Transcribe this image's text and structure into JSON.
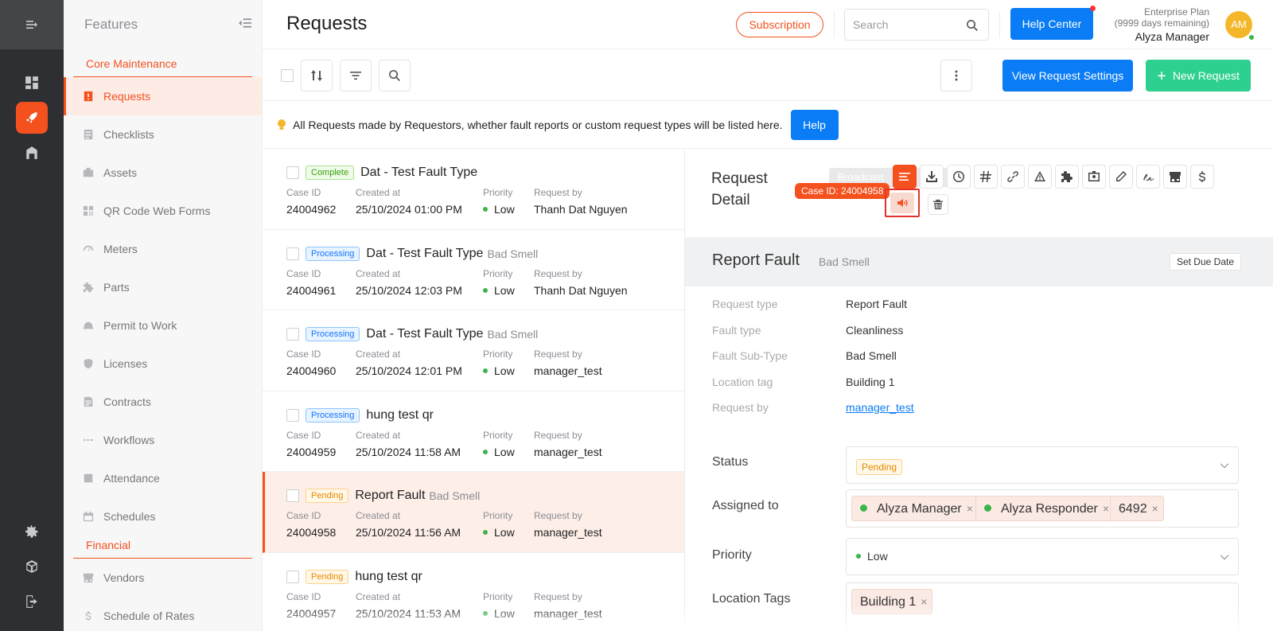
{
  "header": {
    "page_title": "Requests",
    "subscription_label": "Subscription",
    "search_placeholder": "Search",
    "help_center_label": "Help Center",
    "plan_name": "Enterprise Plan",
    "plan_days": "(9999 days remaining)",
    "user_name": "Alyza Manager",
    "avatar_initials": "AM"
  },
  "sidebar": {
    "title": "Features",
    "section_core": "Core Maintenance",
    "section_financial": "Financial",
    "items": [
      {
        "label": "Requests",
        "icon": "request-icon"
      },
      {
        "label": "Checklists",
        "icon": "checklist-icon"
      },
      {
        "label": "Assets",
        "icon": "asset-icon"
      },
      {
        "label": "QR Code Web Forms",
        "icon": "qr-code-icon"
      },
      {
        "label": "Meters",
        "icon": "meter-icon"
      },
      {
        "label": "Parts",
        "icon": "puzzle-icon"
      },
      {
        "label": "Permit to Work",
        "icon": "hard-hat-icon"
      },
      {
        "label": "Licenses",
        "icon": "shield-icon"
      },
      {
        "label": "Contracts",
        "icon": "contract-icon"
      },
      {
        "label": "Workflows",
        "icon": "workflow-icon"
      },
      {
        "label": "Attendance",
        "icon": "attendance-icon"
      },
      {
        "label": "Schedules",
        "icon": "calendar-icon"
      }
    ],
    "financial_items": [
      {
        "label": "Vendors",
        "icon": "store-icon"
      },
      {
        "label": "Schedule of Rates",
        "icon": "dollar-icon"
      }
    ]
  },
  "toolbar": {
    "view_settings_label": "View Request Settings",
    "new_request_label": "New Request"
  },
  "info": {
    "text": "All Requests made by Requestors, whether fault reports or custom request types will be listed here.",
    "help_label": "Help"
  },
  "list_headers": {
    "case_id": "Case ID",
    "created_at": "Created at",
    "priority": "Priority",
    "request_by": "Request by"
  },
  "requests": [
    {
      "status": "Complete",
      "title": "Dat - Test Fault Type",
      "subtitle": "",
      "case_id": "24004962",
      "created_at": "25/10/2024 01:00 PM",
      "priority": "Low",
      "request_by": "Thanh Dat Nguyen"
    },
    {
      "status": "Processing",
      "title": "Dat - Test Fault Type",
      "subtitle": "Bad Smell",
      "case_id": "24004961",
      "created_at": "25/10/2024 12:03 PM",
      "priority": "Low",
      "request_by": "Thanh Dat Nguyen"
    },
    {
      "status": "Processing",
      "title": "Dat - Test Fault Type",
      "subtitle": "Bad Smell",
      "case_id": "24004960",
      "created_at": "25/10/2024 12:01 PM",
      "priority": "Low",
      "request_by": "manager_test"
    },
    {
      "status": "Processing",
      "title": "hung test qr",
      "subtitle": "",
      "case_id": "24004959",
      "created_at": "25/10/2024 11:58 AM",
      "priority": "Low",
      "request_by": "manager_test"
    },
    {
      "status": "Pending",
      "title": "Report Fault",
      "subtitle": "Bad Smell",
      "case_id": "24004958",
      "created_at": "25/10/2024 11:56 AM",
      "priority": "Low",
      "request_by": "manager_test"
    },
    {
      "status": "Pending",
      "title": "hung test qr",
      "subtitle": "",
      "case_id": "24004957",
      "created_at": "25/10/2024 11:53 AM",
      "priority": "Low",
      "request_by": "manager_test"
    }
  ],
  "detail": {
    "title_line1": "Request",
    "title_line2": "Detail",
    "ghost_label": "Broadcast",
    "tooltip": "Case ID: 24004958",
    "report_title": "Report Fault",
    "report_subtitle": "Bad Smell",
    "due_label": "Set Due Date",
    "fields": [
      {
        "key": "Request type",
        "value": "Report Fault"
      },
      {
        "key": "Fault type",
        "value": "Cleanliness"
      },
      {
        "key": "Fault Sub-Type",
        "value": "Bad Smell"
      },
      {
        "key": "Location tag",
        "value": "Building 1"
      },
      {
        "key": "Request by",
        "value": "manager_test"
      }
    ],
    "status_label": "Status",
    "status_value": "Pending",
    "assigned_label": "Assigned to",
    "assignees": [
      "Alyza Manager",
      "Alyza Responder",
      "6492"
    ],
    "priority_label": "Priority",
    "priority_value": "Low",
    "location_label": "Location Tags",
    "location_value": "Building 1"
  },
  "colors": {
    "accent": "#f4511e",
    "primary_blue": "#0a7cf5",
    "green": "#2ed08f"
  }
}
